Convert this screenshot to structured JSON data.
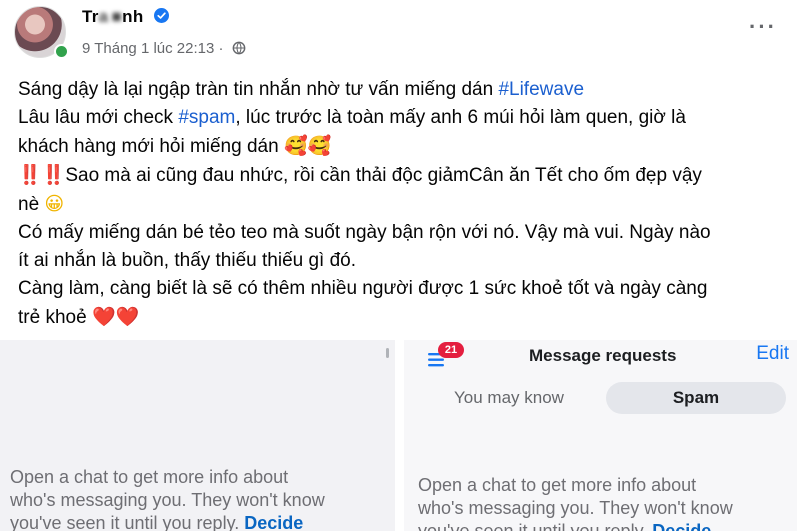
{
  "post": {
    "author_prefix": "Tr",
    "author_masked": "a ■",
    "author_suffix": "nh",
    "time": "9 Tháng 1 lúc 22:13 ·",
    "more_label": "···",
    "lines": {
      "l1_text": "Sáng dậy là lại ngập tràn tin nhắn nhờ tư vấn miếng dán ",
      "l1_tag": "#Lifewave",
      "l2_a": "Lâu lâu mới check ",
      "l2_tag": "#spam",
      "l2_b": ", lúc trước là toàn mấy anh 6 múi hỏi làm quen, giờ là",
      "l3": "khách hàng mới hỏi miếng dán ",
      "l3_emoji": "🥰🥰",
      "l4_emoji": "‼️‼️",
      "l4": "Sao mà ai cũng đau nhức, rồi cần thải độc giảmCân ăn Tết cho ốm đẹp vậy",
      "l5": "nè ",
      "l5_emoji": "😀",
      "l6": "Có mấy miếng dán bé tẻo teo mà suốt ngày bận rộn với nó. Vậy mà vui. Ngày nào",
      "l7": "ít ai nhắn là buồn, thấy thiếu thiếu gì đó.",
      "l8": "Càng làm, càng biết là sẽ có thêm nhiều người được 1 sức khoẻ tốt và ngày càng",
      "l9": "trẻ khoẻ ",
      "l9_emoji": "❤️❤️"
    }
  },
  "left_panel": {
    "text_line1": "Open a chat to get more info about",
    "text_line2": "who's messaging you. They won't know",
    "text_line3": "you've seen it until you reply.",
    "decide": "Decide"
  },
  "right_panel": {
    "badge_count": "21",
    "title": "Message requests",
    "edit": "Edit",
    "tab_known": "You may know",
    "tab_spam": "Spam",
    "text_line1": "Open a chat to get more info about",
    "text_line2": "who's messaging you. They won't know",
    "text_line3": "you've seen it until you reply.",
    "decide": "Decide"
  },
  "colors": {
    "link": "#1b5fcf",
    "edit": "#1877f2",
    "badge": "#e41e3f",
    "online": "#31a24c"
  }
}
